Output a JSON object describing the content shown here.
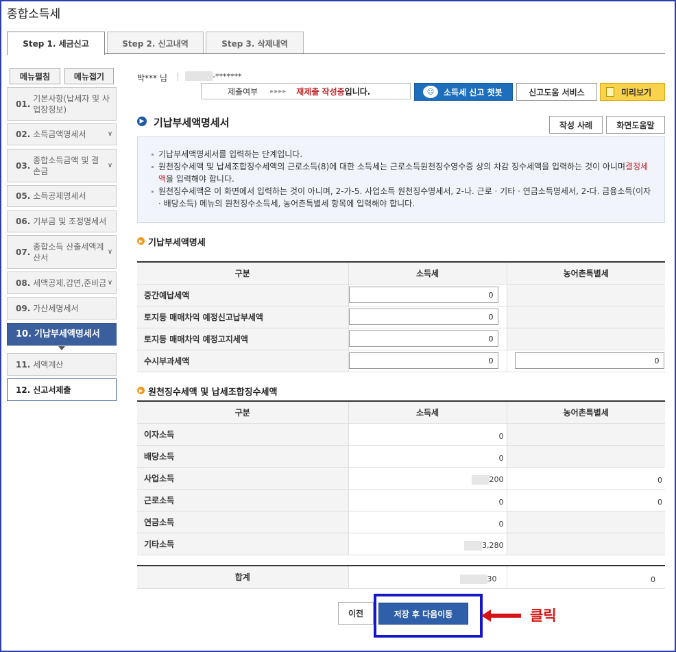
{
  "page_title": "종합소득세",
  "tabs": [
    {
      "label": "Step 1. 세금신고",
      "active": true
    },
    {
      "label": "Step 2. 신고내역",
      "active": false
    },
    {
      "label": "Step 3. 삭제내역",
      "active": false
    }
  ],
  "sidebar": {
    "expand_label": "메뉴펼침",
    "collapse_label": "메뉴접기",
    "items": [
      {
        "num": "01.",
        "label": "기본사항(납세자 및 사업장정보)"
      },
      {
        "num": "02.",
        "label": "소득금액명세서"
      },
      {
        "num": "03.",
        "label": "종합소득금액 및 결손금"
      },
      {
        "num": "05.",
        "label": "소득공제명세서"
      },
      {
        "num": "06.",
        "label": "기부금 및 조정명세서"
      },
      {
        "num": "07.",
        "label": "종합소득 산출세액계산서"
      },
      {
        "num": "08.",
        "label": "세액공제,감면,준비금"
      },
      {
        "num": "09.",
        "label": "가산세명세서"
      },
      {
        "num": "10.",
        "label": "기납부세액명세서"
      },
      {
        "num": "11.",
        "label": "세액계산"
      },
      {
        "num": "12.",
        "label": "신고서제출"
      }
    ]
  },
  "user": {
    "name": "박*** 님",
    "id_suffix": "-*******"
  },
  "status": {
    "label": "제출여부",
    "arrows": "▸▸▸▸",
    "highlight": "재제출 작성중",
    "suffix": "입니다."
  },
  "buttons": {
    "chatbot": "소득세 신고 챗봇",
    "help_service": "신고도움 서비스",
    "preview": "미리보기",
    "example": "작성 사례",
    "screen_help": "화면도움말",
    "prev": "이전",
    "save_next": "저장 후 다음이동"
  },
  "section_title": "기납부세액명세서",
  "info": {
    "line1": "기납부세액명세서를 입력하는 단계입니다.",
    "line2a": "원천징수세액 및 납세조합징수세액의 근로소득(8)에 대한 소득세는 근로소득원천징수영수증 상의 차감 징수세액을 입력하는 것이 아니며",
    "line2_red": "결정세액",
    "line2b": "을 입력해야 합니다.",
    "line3": "원천징수세액은 이 화면에서 입력하는 것이 아니며, 2-가-5. 사업소득 원천징수명세서, 2-나. 근로 · 기타 · 연금소득명세서, 2-다. 금융소득(이자 · 배당소득) 메뉴의 원천징수소득세, 농어촌특별세 항목에 입력해야 합니다."
  },
  "table1": {
    "title": "기납부세액명세",
    "headers": [
      "구분",
      "소득세",
      "농어촌특별세"
    ],
    "rows": [
      {
        "label": "중간예납세액",
        "income_tax": "0",
        "rural_tax": ""
      },
      {
        "label": "토지등 매매차익 예정신고납부세액",
        "income_tax": "0",
        "rural_tax": ""
      },
      {
        "label": "토지등 매매차익 예정고지세액",
        "income_tax": "0",
        "rural_tax": ""
      },
      {
        "label": "수시부과세액",
        "income_tax": "0",
        "rural_tax": "0"
      }
    ]
  },
  "table2": {
    "title": "원천징수세액 및 납세조합징수세액",
    "headers": [
      "구분",
      "소득세",
      "농어촌특별세"
    ],
    "rows": [
      {
        "label": "이자소득",
        "income_tax": "0",
        "rural_tax": ""
      },
      {
        "label": "배당소득",
        "income_tax": "0",
        "rural_tax": ""
      },
      {
        "label": "사업소득",
        "income_tax": "200",
        "rural_tax": "0"
      },
      {
        "label": "근로소득",
        "income_tax": "0",
        "rural_tax": "0"
      },
      {
        "label": "연금소득",
        "income_tax": "0",
        "rural_tax": ""
      },
      {
        "label": "기타소득",
        "income_tax": "3,280",
        "rural_tax": ""
      }
    ],
    "total_label": "합계",
    "total_income_tax": "30",
    "total_rural_tax": "0"
  },
  "annotation": {
    "label": "클릭",
    "color": "#d51515",
    "box_color": "#1616c9"
  }
}
